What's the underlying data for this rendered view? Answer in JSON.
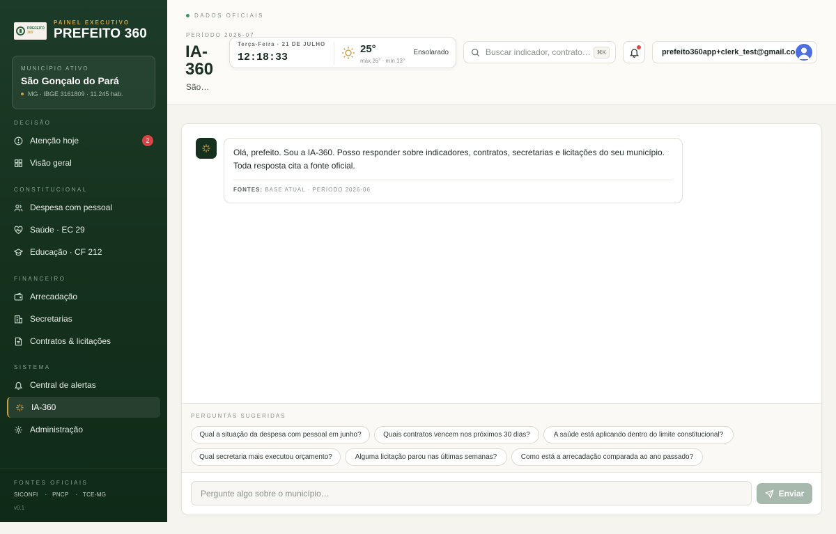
{
  "brand": {
    "kicker": "PAINEL EXECUTIVO",
    "title": "PREFEITO 360",
    "logo_top": "PREFEITO",
    "logo_bottom": "360"
  },
  "municipio": {
    "label": "MUNICÍPIO ATIVO",
    "name": "São Gonçalo do Pará",
    "info": "MG · IBGE 3161809 · 11.245 hab."
  },
  "sidebar": {
    "sections": [
      {
        "label": "DECISÃO",
        "items": [
          {
            "label": "Atenção hoje",
            "icon": "alert-circle-icon",
            "badge": "2"
          },
          {
            "label": "Visão geral",
            "icon": "grid-icon"
          }
        ]
      },
      {
        "label": "CONSTITUCIONAL",
        "items": [
          {
            "label": "Despesa com pessoal",
            "icon": "users-icon"
          },
          {
            "label": "Saúde · EC 29",
            "icon": "heart-pulse-icon"
          },
          {
            "label": "Educação · CF 212",
            "icon": "graduation-cap-icon"
          }
        ]
      },
      {
        "label": "FINANCEIRO",
        "items": [
          {
            "label": "Arrecadação",
            "icon": "wallet-icon"
          },
          {
            "label": "Secretarias",
            "icon": "building-icon"
          },
          {
            "label": "Contratos & licitações",
            "icon": "document-icon"
          }
        ]
      },
      {
        "label": "SISTEMA",
        "items": [
          {
            "label": "Central de alertas",
            "icon": "bell-icon"
          },
          {
            "label": "IA-360",
            "icon": "sparkles-icon",
            "active": true
          },
          {
            "label": "Administração",
            "icon": "gear-icon"
          }
        ]
      }
    ],
    "footer": {
      "label": "FONTES OFICIAIS",
      "sources": [
        "SICONFI",
        "PNCP",
        "TCE-MG"
      ],
      "version": "v0.1"
    }
  },
  "header": {
    "kicker": "DADOS OFICIAIS",
    "period": "PERÍODO 2026-07",
    "title": "IA-360",
    "subtitle": "São…",
    "clock": {
      "date": "Terça-Feira · 21 DE JULHO",
      "time": "12:18:33"
    },
    "weather": {
      "temp": "25°",
      "range": "máx 26° · mín 13°",
      "condition": "Ensolarado",
      "icon": "sun-icon"
    },
    "search": {
      "placeholder": "Buscar indicador, contrato…",
      "shortcut": "⌘K"
    },
    "user": {
      "email": "prefeito360app+clerk_test@gmail.com"
    }
  },
  "chat": {
    "message": "Olá, prefeito. Sou a IA-360. Posso responder sobre indicadores, contratos, secretarias e licitações do seu município. Toda resposta cita a fonte oficial.",
    "sources_label": "FONTES:",
    "sources_value": "BASE ATUAL · PERÍODO 2026-06",
    "suggestions_label": "PERGUNTAS SUGERIDAS",
    "suggestions": [
      "Qual a situação da despesa com pessoal em junho?",
      "Quais contratos vencem nos próximos 30 dias?",
      "A saúde está aplicando dentro do limite constitucional?",
      "Qual secretaria mais executou orçamento?",
      "Alguma licitação parou nas últimas semanas?",
      "Como está a arrecadação comparada ao ano passado?"
    ],
    "composer_placeholder": "Pergunte algo sobre o município…",
    "send_label": "Enviar"
  }
}
